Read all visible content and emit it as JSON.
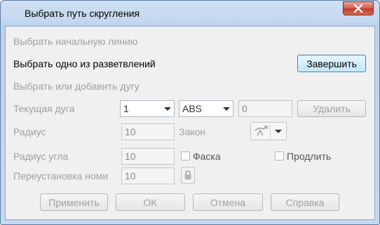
{
  "window": {
    "title": "Выбрать путь скругления"
  },
  "steps": {
    "start_line": "Выбрать начальную линию",
    "branch": "Выбрать одно из разветвлений",
    "arc": "Выбрать или добавить дугу"
  },
  "buttons": {
    "finish": "Завершить",
    "delete": "Удалить",
    "apply": "Применить",
    "ok": "OK",
    "cancel": "Отмена",
    "help": "Справка"
  },
  "form": {
    "current_arc_label": "Текущая дуга",
    "current_arc_value": "1",
    "mode_value": "ABS",
    "mode_number": "0",
    "radius_label": "Радиус",
    "radius_value": "10",
    "law_label": "Закон",
    "angle_radius_label": "Радиус угла",
    "angle_radius_value": "10",
    "chamfer_label": "Фаска",
    "extend_label": "Продлить",
    "reset_label": "Переустановка номи",
    "reset_value": "10"
  },
  "icons": {
    "close": "close-icon",
    "law": "law-icon",
    "lock": "lock-icon"
  }
}
